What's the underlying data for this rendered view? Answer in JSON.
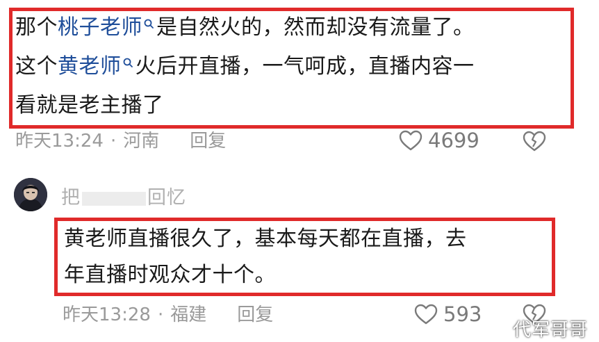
{
  "comments": [
    {
      "lines": [
        {
          "pre": "那个",
          "mention": "桃子老师",
          "post": "是自然火的，然而却没有流量了。"
        },
        {
          "pre": "这个",
          "mention": "黄老师",
          "post": "火后开直播，一气呵成，直播内容一"
        },
        {
          "pre": "看就是老主播了",
          "mention": "",
          "post": ""
        }
      ],
      "time": "昨天13:24",
      "separator": "·",
      "location": "河南",
      "reply_label": "回复",
      "likes": "4699"
    },
    {
      "username": "把",
      "username_tail": "回忆",
      "lines": [
        "黄老师直播很久了，基本每天都在直播，去",
        "年直播时观众才十个。"
      ],
      "time": "昨天13:28",
      "separator": "·",
      "location": "福建",
      "reply_label": "回复",
      "likes": "593"
    }
  ],
  "watermark": "代军哥哥",
  "colors": {
    "highlight_border": "#e02a2a",
    "mention": "#1f4e9a",
    "meta": "#9a9a9a"
  },
  "icons": [
    "search-icon",
    "heart-icon",
    "broken-heart-icon",
    "avatar"
  ]
}
